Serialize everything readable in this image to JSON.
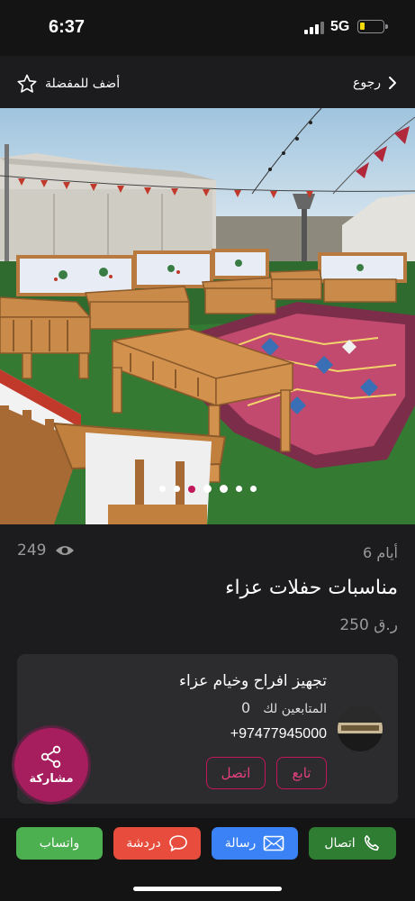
{
  "status": {
    "time": "6:37",
    "network": "5G",
    "battery_level": 0.2
  },
  "nav": {
    "favorite_label": "أضف للمفضلة",
    "back_label": "رجوع"
  },
  "gallery": {
    "image_count": 7,
    "active_index": 2
  },
  "listing": {
    "views": "249",
    "posted": "6 أيام",
    "title": "مناسبات حفلات عزاء",
    "price": "250 ر.ق"
  },
  "seller": {
    "name": "تجهيز افراح وخيام عزاء",
    "followers_label": "المتابعين لك",
    "followers_count": "0",
    "phone": "+97477945000",
    "follow_label": "تابع",
    "call_label": "اتصل"
  },
  "share": {
    "label": "مشاركة"
  },
  "actions": {
    "whatsapp": "واتساب",
    "chat": "دردشة",
    "message": "رسالة",
    "call": "اتصال"
  },
  "colors": {
    "accent": "#c2185b",
    "whatsapp": "#4caf50",
    "chat": "#e74c3c",
    "message": "#3b82f6",
    "call": "#2e7d32"
  }
}
